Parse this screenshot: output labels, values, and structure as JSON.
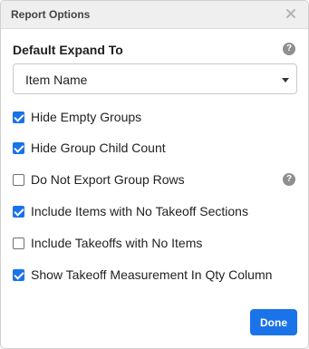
{
  "header": {
    "title": "Report Options"
  },
  "expand": {
    "label": "Default Expand To",
    "selected": "Item Name"
  },
  "options": [
    {
      "label": "Hide Empty Groups",
      "checked": true,
      "help": false
    },
    {
      "label": "Hide Group Child Count",
      "checked": true,
      "help": false
    },
    {
      "label": "Do Not Export Group Rows",
      "checked": false,
      "help": true
    },
    {
      "label": "Include Items with No Takeoff Sections",
      "checked": true,
      "help": false
    },
    {
      "label": "Include Takeoffs with No Items",
      "checked": false,
      "help": false
    },
    {
      "label": "Show Takeoff Measurement In Qty Column",
      "checked": true,
      "help": false
    }
  ],
  "icons": {
    "close": "close-icon",
    "help": "question-circle-icon",
    "help_glyph": "?",
    "caret": "chevron-down-icon"
  },
  "footer": {
    "done_label": "Done"
  },
  "colors": {
    "accent": "#1a73e8",
    "header_bg": "#efefef",
    "help_icon": "#8f8f8f"
  }
}
